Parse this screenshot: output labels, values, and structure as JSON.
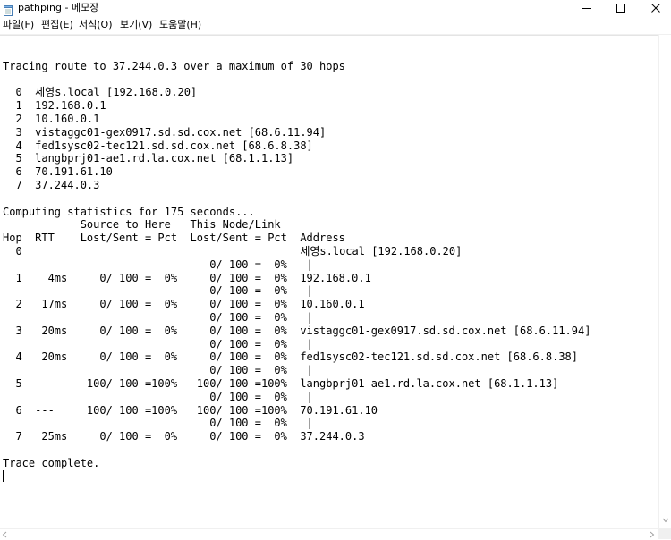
{
  "window": {
    "title": "pathping - 메모장"
  },
  "titlebar": {
    "icon": "notepad-icon",
    "minimize_icon": "minimize-icon",
    "maximize_icon": "maximize-icon",
    "close_icon": "close-icon"
  },
  "menu": {
    "items": [
      {
        "label": "파일(F)"
      },
      {
        "label": "편집(E)"
      },
      {
        "label": "서식(O)"
      },
      {
        "label": "보기(V)"
      },
      {
        "label": "도움말(H)"
      }
    ]
  },
  "editor": {
    "lines": [
      "",
      "Tracing route to 37.244.0.3 over a maximum of 30 hops",
      "",
      "  0  세영s.local [192.168.0.20]",
      "  1  192.168.0.1",
      "  2  10.160.0.1",
      "  3  vistaggc01-gex0917.sd.sd.cox.net [68.6.11.94]",
      "  4  fed1sysc02-tec121.sd.sd.cox.net [68.6.8.38]",
      "  5  langbprj01-ae1.rd.la.cox.net [68.1.1.13]",
      "  6  70.191.61.10",
      "  7  37.244.0.3",
      "",
      "Computing statistics for 175 seconds...",
      "            Source to Here   This Node/Link",
      "Hop  RTT    Lost/Sent = Pct  Lost/Sent = Pct  Address",
      "  0                                           세영s.local [192.168.0.20]",
      "                                0/ 100 =  0%   |",
      "  1    4ms     0/ 100 =  0%     0/ 100 =  0%  192.168.0.1",
      "                                0/ 100 =  0%   |",
      "  2   17ms     0/ 100 =  0%     0/ 100 =  0%  10.160.0.1",
      "                                0/ 100 =  0%   |",
      "  3   20ms     0/ 100 =  0%     0/ 100 =  0%  vistaggc01-gex0917.sd.sd.cox.net [68.6.11.94]",
      "                                0/ 100 =  0%   |",
      "  4   20ms     0/ 100 =  0%     0/ 100 =  0%  fed1sysc02-tec121.sd.sd.cox.net [68.6.8.38]",
      "                                0/ 100 =  0%   |",
      "  5  ---     100/ 100 =100%   100/ 100 =100%  langbprj01-ae1.rd.la.cox.net [68.1.1.13]",
      "                                0/ 100 =  0%   |",
      "  6  ---     100/ 100 =100%   100/ 100 =100%  70.191.61.10",
      "                                0/ 100 =  0%   |",
      "  7   25ms     0/ 100 =  0%     0/ 100 =  0%  37.244.0.3",
      "",
      "Trace complete."
    ]
  },
  "scrollbars": {
    "up_icon": "scroll-down-arrow-icon",
    "left_icon": "scroll-left-arrow-icon",
    "right_icon": "scroll-right-arrow-icon"
  }
}
